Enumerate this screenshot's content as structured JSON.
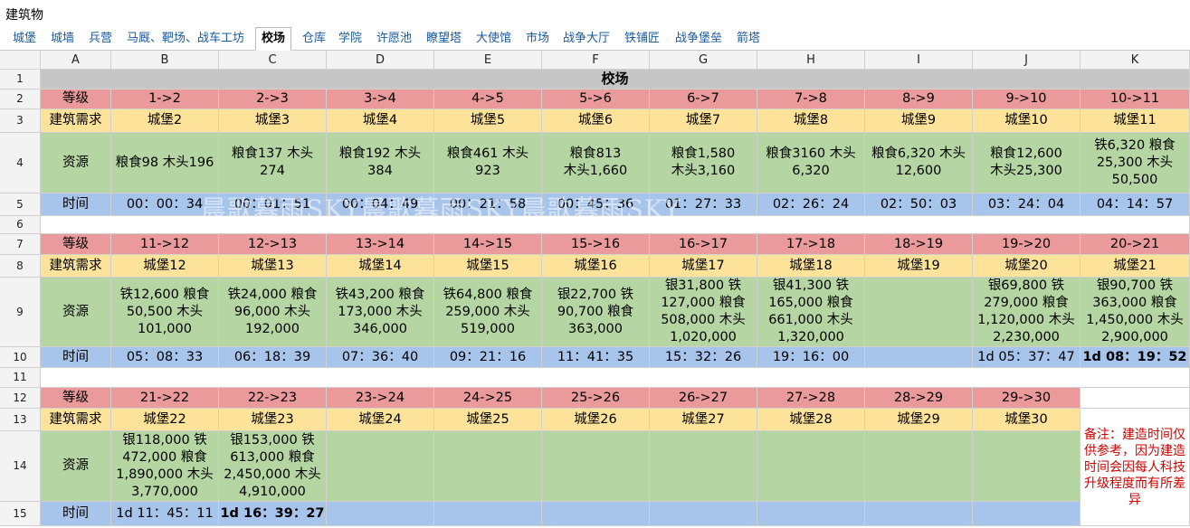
{
  "window_title": "建筑物",
  "tabs": [
    "城堡",
    "城墙",
    "兵营",
    "马厩、靶场、战车工坊",
    "校场",
    "仓库",
    "学院",
    "许愿池",
    "瞭望塔",
    "大使馆",
    "市场",
    "战争大厅",
    "铁铺匠",
    "战争堡垒",
    "箭塔"
  ],
  "active_tab": "校场",
  "columns": [
    "A",
    "B",
    "C",
    "D",
    "E",
    "F",
    "G",
    "H",
    "I",
    "J",
    "K"
  ],
  "row_numbers": [
    "1",
    "2",
    "3",
    "4",
    "5",
    "6",
    "7",
    "8",
    "9",
    "10",
    "11",
    "12",
    "13",
    "14",
    "15"
  ],
  "sheet_title": "校场",
  "labels": {
    "level": "等级",
    "requirement": "建筑需求",
    "resource": "资源",
    "time": "时间"
  },
  "block1": {
    "levels": [
      "1->2",
      "2->3",
      "3->4",
      "4->5",
      "5->6",
      "6->7",
      "7->8",
      "8->9",
      "9->10",
      "10->11"
    ],
    "requirements": [
      "城堡2",
      "城堡3",
      "城堡4",
      "城堡5",
      "城堡6",
      "城堡7",
      "城堡8",
      "城堡9",
      "城堡10",
      "城堡11"
    ],
    "resources": [
      "粮食98 木头196",
      "粮食137 木头\n274",
      "粮食192 木头\n384",
      "粮食461 木头\n923",
      "粮食813\n木头1,660",
      "粮食1,580\n木头3,160",
      "粮食3160 木头\n6,320",
      "粮食6,320 木头\n12,600",
      "粮食12,600\n木头25,300",
      "铁6,320 粮食\n25,300 木头\n50,500"
    ],
    "times": [
      "00：00：34",
      "00：01：51",
      "00：04：49",
      "00：21：58",
      "00：45：36",
      "01：27：33",
      "02：26：24",
      "02：50：03",
      "03：24：04",
      "04：14：57"
    ]
  },
  "block2": {
    "levels": [
      "11->12",
      "12->13",
      "13->14",
      "14->15",
      "15->16",
      "16->17",
      "17->18",
      "18->19",
      "19->20",
      "20->21"
    ],
    "requirements": [
      "城堡12",
      "城堡13",
      "城堡14",
      "城堡15",
      "城堡16",
      "城堡17",
      "城堡18",
      "城堡19",
      "城堡20",
      "城堡21"
    ],
    "resources": [
      "铁12,600 粮食\n50,500 木头\n101,000",
      "铁24,000 粮食\n96,000 木头\n192,000",
      "铁43,200 粮食\n173,000 木头\n346,000",
      "铁64,800 粮食\n259,000 木头\n519,000",
      "银22,700 铁\n90,700 粮食\n363,000",
      "银31,800 铁\n127,000 粮食\n508,000 木头\n1,020,000",
      "银41,300 铁\n165,000 粮食\n661,000 木头\n1,320,000",
      "",
      "银69,800 铁\n279,000 粮食\n1,120,000 木头\n2,230,000",
      "银90,700 铁\n363,000 粮食\n1,450,000 木头\n2,900,000"
    ],
    "times": [
      "05：08：33",
      "06：18：39",
      "07：36：40",
      "09：21：16",
      "11：41：35",
      "15：32：26",
      "19：16：00",
      "",
      "1d 05：37：47",
      "1d 08：19：52"
    ]
  },
  "block3": {
    "levels": [
      "21->22",
      "22->23",
      "23->24",
      "24->25",
      "25->26",
      "26->27",
      "27->28",
      "28->29",
      "29->30"
    ],
    "requirements": [
      "城堡22",
      "城堡23",
      "城堡24",
      "城堡25",
      "城堡26",
      "城堡27",
      "城堡28",
      "城堡29",
      "城堡30"
    ],
    "resources": [
      "银118,000 铁\n472,000 粮食\n1,890,000 木头\n3,770,000",
      "银153,000 铁\n613,000 粮食\n2,450,000 木头\n4,910,000",
      "",
      "",
      "",
      "",
      "",
      "",
      ""
    ],
    "times": [
      "1d 11：45：11",
      "1d 16：39：27",
      "",
      "",
      "",
      "",
      "",
      "",
      ""
    ]
  },
  "note": "备注：建造时间仅供参考，因为建造时间会因每人科技升级程度而有所差异",
  "watermark": "晨歌暮雨SKY晨歌暮雨SKY晨歌暮雨SKY",
  "colors": {
    "level": "#ea9a9a",
    "requirement": "#fde29a",
    "resource": "#b5d6a3",
    "time": "#a7c4eb",
    "title": "#c6c6c6",
    "note": "#cc0000",
    "tab_link": "#1a5aa0"
  }
}
